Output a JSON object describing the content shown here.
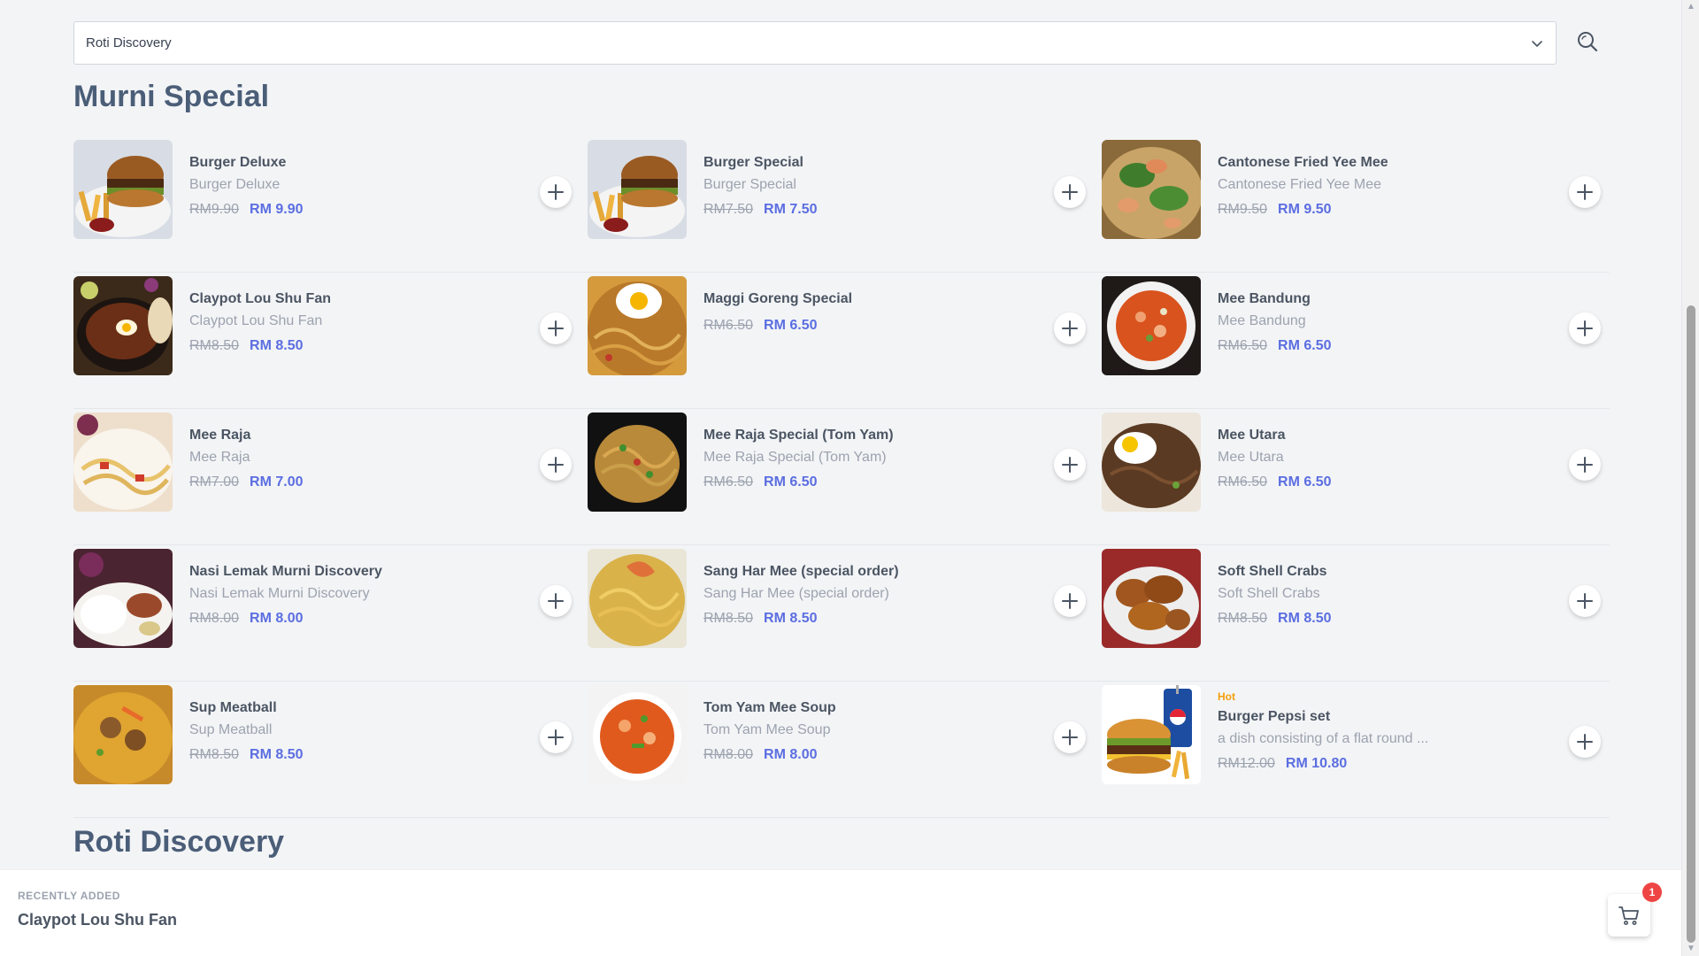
{
  "header": {
    "category_select": {
      "value": "Roti Discovery"
    }
  },
  "sections": [
    {
      "title": "Murni Special"
    },
    {
      "title": "Roti Discovery"
    }
  ],
  "items": [
    {
      "name": "Burger Deluxe",
      "desc": "Burger Deluxe",
      "old_price": "RM9.90",
      "price": "RM 9.90",
      "image": "burger-fries-photo"
    },
    {
      "name": "Burger Special",
      "desc": "Burger Special",
      "old_price": "RM7.50",
      "price": "RM 7.50",
      "image": "burger-fries-photo"
    },
    {
      "name": "Cantonese Fried Yee Mee",
      "desc": "Cantonese Fried Yee Mee",
      "old_price": "RM9.50",
      "price": "RM 9.50",
      "image": "seafood-noodle-photo"
    },
    {
      "name": "Claypot Lou Shu Fan",
      "desc": "Claypot Lou Shu Fan",
      "old_price": "RM8.50",
      "price": "RM 8.50",
      "image": "claypot-photo"
    },
    {
      "name": "Maggi Goreng Special",
      "desc": "",
      "old_price": "RM6.50",
      "price": "RM 6.50",
      "image": "fried-noodle-egg-photo"
    },
    {
      "name": "Mee Bandung",
      "desc": "Mee Bandung",
      "old_price": "RM6.50",
      "price": "RM 6.50",
      "image": "red-soup-photo"
    },
    {
      "name": "Mee Raja",
      "desc": "Mee Raja",
      "old_price": "RM7.00",
      "price": "RM 7.00",
      "image": "yellow-noodle-photo"
    },
    {
      "name": "Mee Raja Special (Tom Yam)",
      "desc": "Mee Raja Special (Tom Yam)",
      "old_price": "RM6.50",
      "price": "RM 6.50",
      "image": "fried-noodle-photo"
    },
    {
      "name": "Mee Utara",
      "desc": "Mee Utara",
      "old_price": "RM6.50",
      "price": "RM 6.50",
      "image": "dark-noodle-egg-photo"
    },
    {
      "name": "Nasi Lemak Murni Discovery",
      "desc": "Nasi Lemak Murni Discovery",
      "old_price": "RM8.00",
      "price": "RM 8.00",
      "image": "rice-plate-photo"
    },
    {
      "name": "Sang Har Mee (special order)",
      "desc": "Sang Har Mee (special order)",
      "old_price": "RM8.50",
      "price": "RM 8.50",
      "image": "prawn-noodle-photo"
    },
    {
      "name": "Soft Shell Crabs",
      "desc": "Soft Shell Crabs",
      "old_price": "RM8.50",
      "price": "RM 8.50",
      "image": "fried-crab-photo"
    },
    {
      "name": "Sup Meatball",
      "desc": "Sup Meatball",
      "old_price": "RM8.50",
      "price": "RM 8.50",
      "image": "meatball-soup-photo"
    },
    {
      "name": "Tom Yam Mee Soup",
      "desc": "Tom Yam Mee Soup",
      "old_price": "RM8.00",
      "price": "RM 8.00",
      "image": "tomyam-soup-photo"
    },
    {
      "name": "Burger Pepsi set",
      "desc": "a dish consisting of a flat round ...",
      "old_price": "RM12.00",
      "price": "RM 10.80",
      "badge": "Hot",
      "image": "burger-pepsi-photo"
    }
  ],
  "footer": {
    "label": "RECENTLY ADDED",
    "recent_item": "Claypot Lou Shu Fan",
    "cart_count": "1"
  },
  "colors": {
    "accent_price": "#5b6ee1",
    "hot_badge": "#f59e0b",
    "cart_badge": "#ef4444"
  }
}
